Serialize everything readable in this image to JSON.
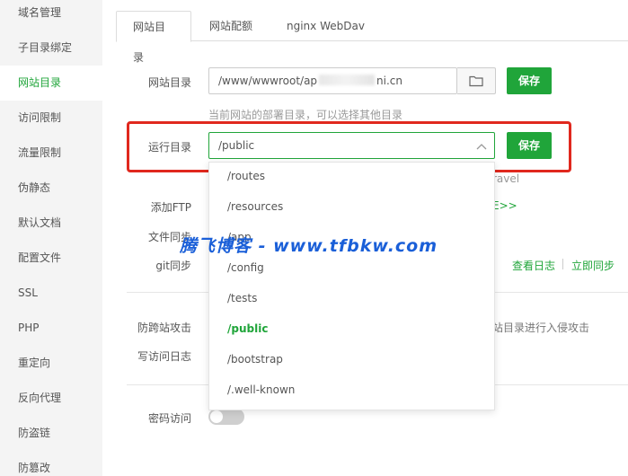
{
  "sidebar": {
    "items": [
      {
        "label": "域名管理"
      },
      {
        "label": "子目录绑定"
      },
      {
        "label": "网站目录"
      },
      {
        "label": "访问限制"
      },
      {
        "label": "流量限制"
      },
      {
        "label": "伪静态"
      },
      {
        "label": "默认文档"
      },
      {
        "label": "配置文件"
      },
      {
        "label": "SSL"
      },
      {
        "label": "PHP"
      },
      {
        "label": "重定向"
      },
      {
        "label": "反向代理"
      },
      {
        "label": "防盗链"
      },
      {
        "label": "防篡改"
      }
    ]
  },
  "tabs": [
    {
      "label": "网站目录"
    },
    {
      "label": "网站配额"
    },
    {
      "label": "nginx WebDav"
    }
  ],
  "site_dir": {
    "label": "网站目录",
    "value_start": "/www/wwwroot/ap",
    "value_end": "ni.cn",
    "hint": "当前网站的部署目录，可以选择其他目录",
    "save": "保存"
  },
  "run_dir": {
    "label": "运行目录",
    "value": "/public",
    "hint_partial": "ravel",
    "save": "保存",
    "options": [
      "/routes",
      "/resources",
      "/app",
      "/config",
      "/tests",
      "/public",
      "/bootstrap",
      "/.well-known"
    ],
    "selected": "/public"
  },
  "ftp": {
    "label": "添加FTP",
    "link_partial": "E>>"
  },
  "file_sync": {
    "label": "文件同步"
  },
  "git_sync": {
    "label": "git同步",
    "view_log": "查看日志",
    "sync_now": "立即同步"
  },
  "anti_xss": {
    "label": "防跨站攻击",
    "hint_partial": "站目录进行入侵攻击"
  },
  "access_log": {
    "label": "写访问日志"
  },
  "password_access": {
    "label": "密码访问",
    "enabled": false
  },
  "watermark": "腾飞博客 - www.tfbkw.com",
  "colors": {
    "accent": "#20a53a",
    "highlight": "#e0281e",
    "watermark": "#1a5fd8"
  }
}
